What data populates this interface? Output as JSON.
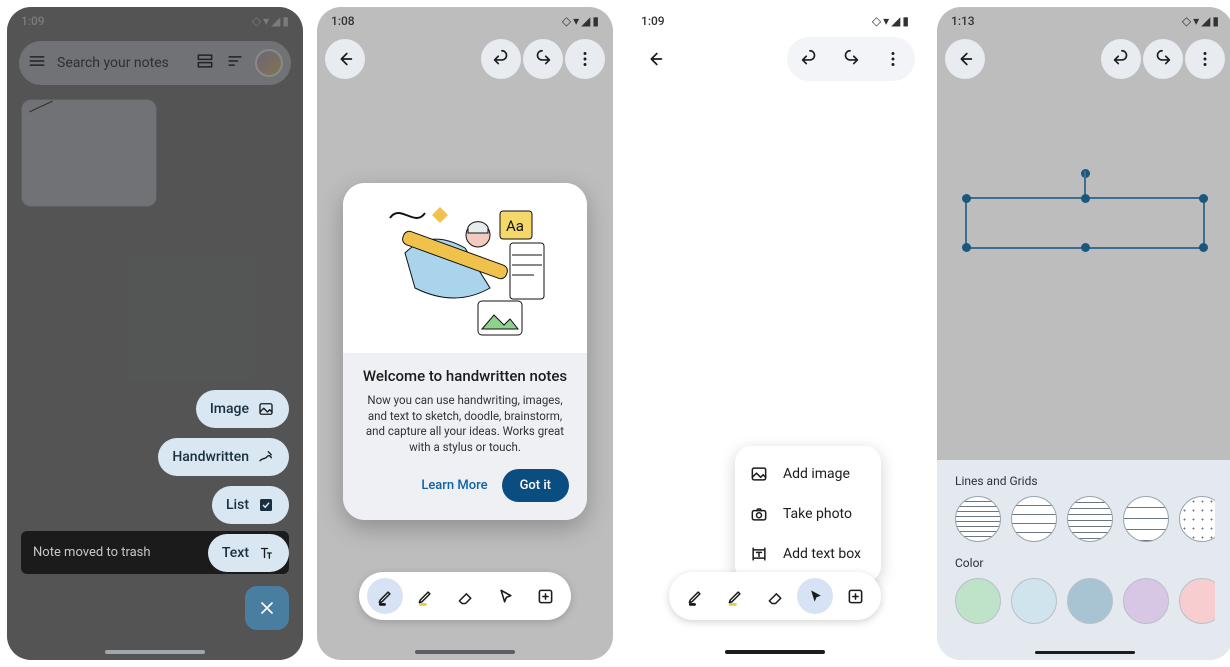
{
  "screen1": {
    "time": "1:09",
    "search_placeholder": "Search your notes",
    "toast_text": "Note moved to trash",
    "fab_items": [
      {
        "label": "Image",
        "icon": "image"
      },
      {
        "label": "Handwritten",
        "icon": "draw"
      },
      {
        "label": "List",
        "icon": "check"
      },
      {
        "label": "Text",
        "icon": "text"
      }
    ]
  },
  "screen2": {
    "time": "1:08",
    "modal_title": "Welcome to handwritten notes",
    "modal_body": "Now you can use handwriting, images, and text to sketch, doodle, brainstorm, and capture all your ideas. Works great with a stylus or touch.",
    "learn_more": "Learn More",
    "got_it": "Got it"
  },
  "screen3": {
    "time": "1:09",
    "menu_items": [
      {
        "label": "Add image",
        "icon": "image"
      },
      {
        "label": "Take photo",
        "icon": "camera"
      },
      {
        "label": "Add text box",
        "icon": "textbox"
      }
    ]
  },
  "screen4": {
    "time": "1:13",
    "sheet_section1": "Lines and Grids",
    "sheet_section2": "Color",
    "colors": [
      "#bfe3c8",
      "#cfe4ec",
      "#a8c3d2",
      "#d8c7e4",
      "#f7cdd0",
      "#f1e2be",
      "#f3f3f3"
    ]
  }
}
